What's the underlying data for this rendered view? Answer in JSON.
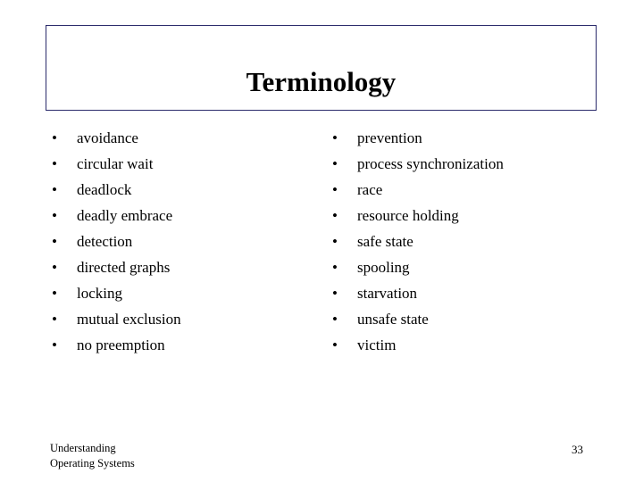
{
  "slide": {
    "title": "Terminology",
    "bullet_char": "•",
    "left_column": [
      "avoidance",
      "circular wait",
      "deadlock",
      "deadly embrace",
      "detection",
      "directed graphs",
      "locking",
      "mutual exclusion",
      "no preemption"
    ],
    "right_column": [
      "prevention",
      "process synchronization",
      "race",
      "resource holding",
      "safe state",
      "spooling",
      "starvation",
      "unsafe state",
      "victim"
    ],
    "footer": {
      "line1": "Understanding",
      "line2": "Operating Systems"
    },
    "page_number": "33",
    "colors": {
      "title_border": "#2b2b6b",
      "text": "#000000",
      "background": "#ffffff"
    }
  }
}
